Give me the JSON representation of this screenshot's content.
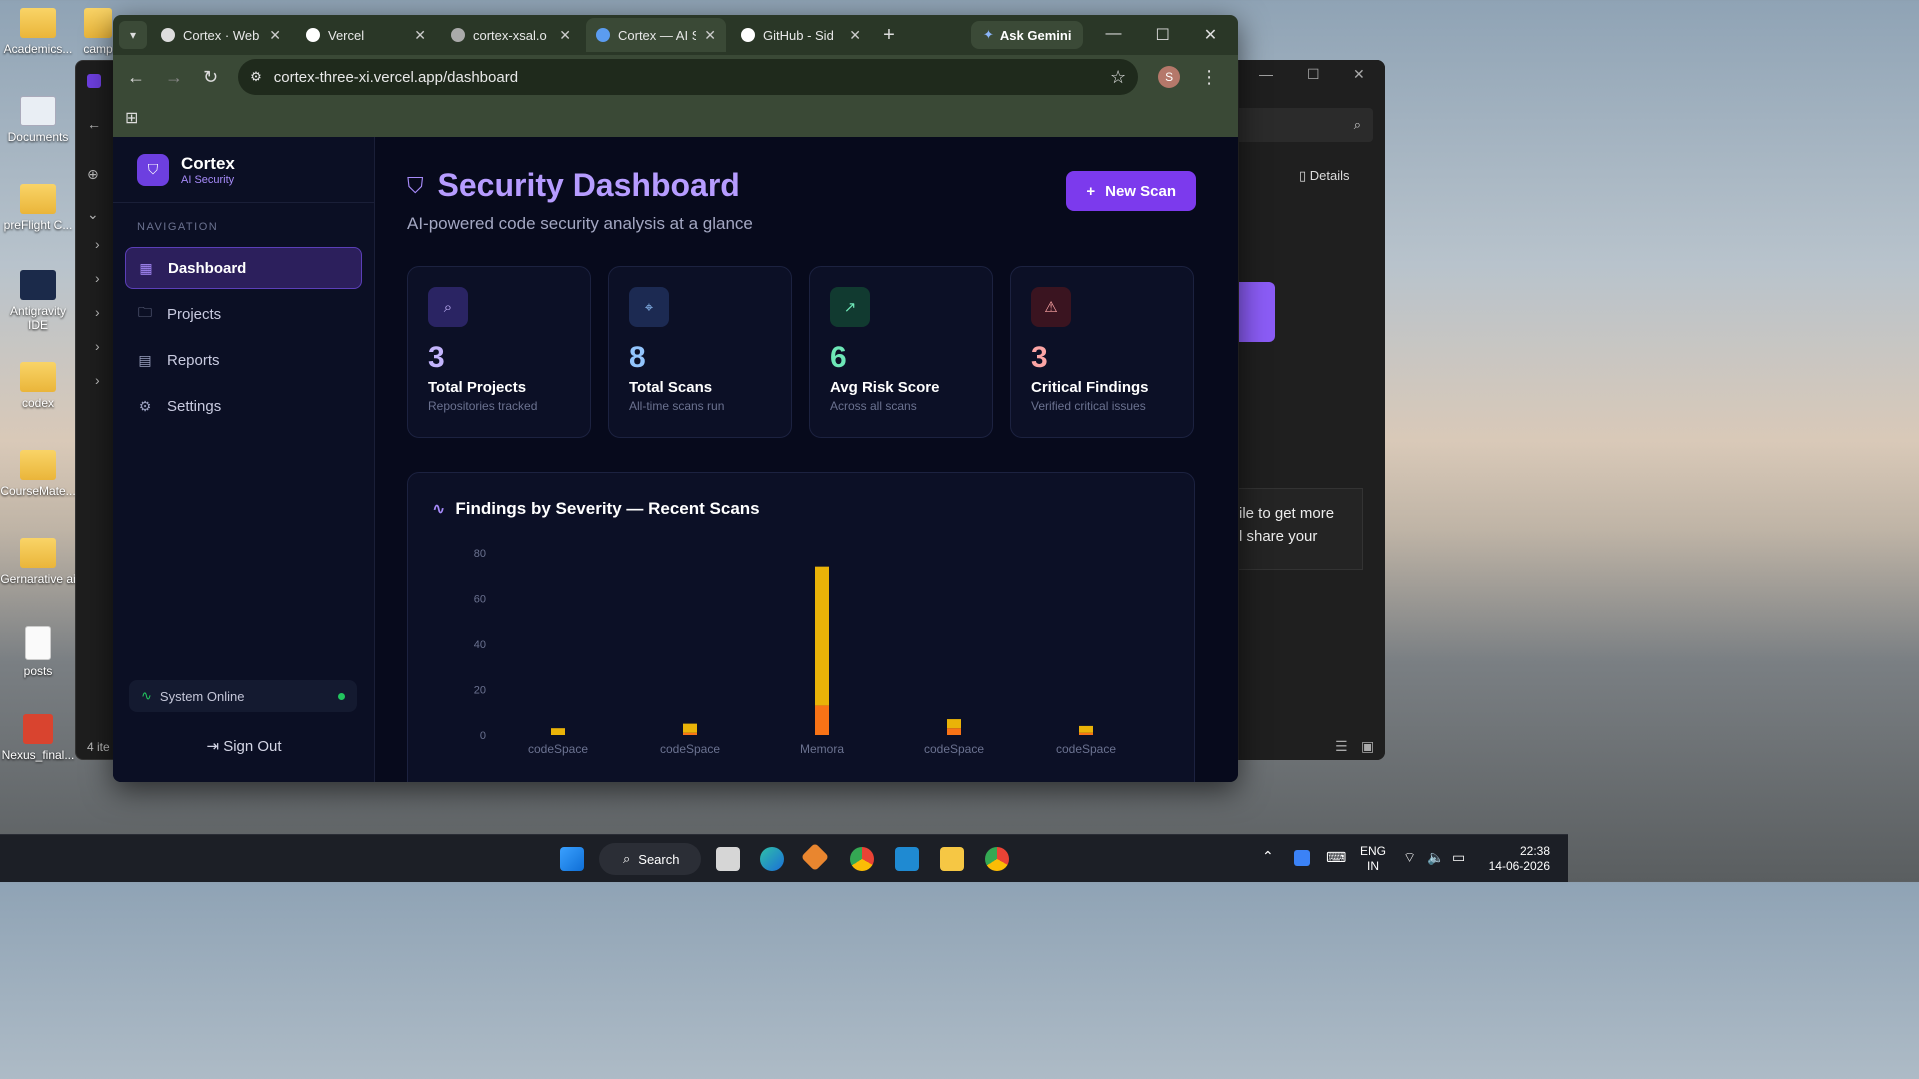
{
  "desktop": {
    "icons": [
      {
        "label": "Academics..."
      },
      {
        "label": "Documents"
      },
      {
        "label": "preFlight C..."
      },
      {
        "label": "Antigravity IDE"
      },
      {
        "label": "codex"
      },
      {
        "label": "CourseMate..."
      },
      {
        "label": "Gernarative ai"
      },
      {
        "label": "posts"
      },
      {
        "label": "Nexus_final..."
      }
    ],
    "partial_icon": "camp",
    "bg_window": {
      "details_label": "Details",
      "tip_line1": "ile to get more",
      "tip_line2": "l share your",
      "status_count": "4 ite"
    }
  },
  "browser": {
    "tabs": [
      {
        "title": "Cortex · Web",
        "fav_color": "#dddddd"
      },
      {
        "title": "Vercel",
        "fav_color": "#ffffff"
      },
      {
        "title": "cortex-xsal.o",
        "fav_color": "#aaaaaa"
      },
      {
        "title": "Cortex — AI S",
        "fav_color": "#5b9cf0",
        "active": true
      },
      {
        "title": "GitHub - Sid",
        "fav_color": "#ffffff"
      }
    ],
    "new_tab": "+",
    "gemini_label": "Ask Gemini",
    "url": "cortex-three-xi.vercel.app/dashboard",
    "profile_initial": "S"
  },
  "app": {
    "brand": {
      "name": "Cortex",
      "sub": "AI Security"
    },
    "nav_heading": "NAVIGATION",
    "nav": [
      {
        "label": "Dashboard",
        "icon": "grid-icon",
        "active": true
      },
      {
        "label": "Projects",
        "icon": "folder-icon"
      },
      {
        "label": "Reports",
        "icon": "file-icon"
      },
      {
        "label": "Settings",
        "icon": "gear-icon"
      }
    ],
    "system_status": "System Online",
    "sign_out": "Sign Out",
    "page_title": "Security Dashboard",
    "page_subtitle": "AI-powered code security analysis at a glance",
    "new_scan_label": "New Scan",
    "stats": [
      {
        "value": "3",
        "label": "Total Projects",
        "sub": "Repositories tracked",
        "color": "#c4b5fd",
        "icon_bg": "#2a2463",
        "icon": "folder-search-icon"
      },
      {
        "value": "8",
        "label": "Total Scans",
        "sub": "All-time scans run",
        "color": "#93c5fd",
        "icon_bg": "#1c2a52",
        "icon": "scan-icon"
      },
      {
        "value": "6",
        "label": "Avg Risk Score",
        "sub": "Across all scans",
        "color": "#6ee7b7",
        "icon_bg": "#113a30",
        "icon": "trending-up-icon"
      },
      {
        "value": "3",
        "label": "Critical Findings",
        "sub": "Verified critical issues",
        "color": "#fca5a5",
        "icon_bg": "#3a1420",
        "icon": "alert-triangle-icon"
      }
    ]
  },
  "chart_data": {
    "type": "bar",
    "title": "Findings by Severity — Recent Scans",
    "categories": [
      "codeSpace",
      "codeSpace",
      "Memora",
      "codeSpace",
      "codeSpace"
    ],
    "ylim": [
      0,
      80
    ],
    "yticks": [
      0,
      20,
      40,
      60,
      80
    ],
    "stacked": true,
    "series": [
      {
        "name": "",
        "color": "#f97316",
        "values": [
          0,
          1,
          13,
          3,
          1
        ]
      },
      {
        "name": "",
        "color": "#eab308",
        "values": [
          3,
          4,
          61,
          4,
          3
        ]
      }
    ]
  },
  "taskbar": {
    "search_label": "Search",
    "lang_top": "ENG",
    "lang_bottom": "IN",
    "time": "22:38",
    "date": "14-06-2026"
  }
}
